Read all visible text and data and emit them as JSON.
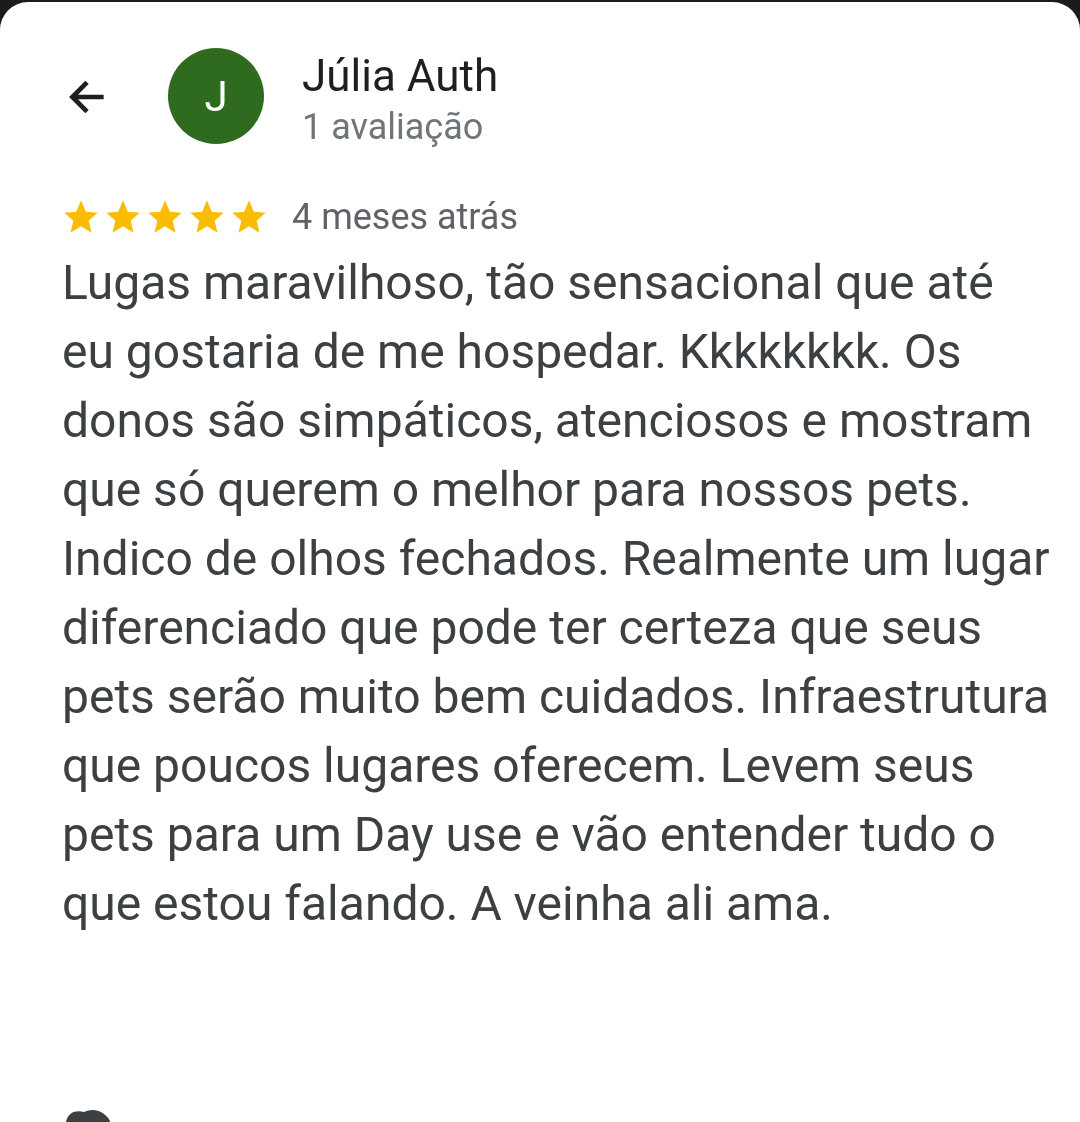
{
  "reviewer": {
    "avatar_letter": "J",
    "name": "Júlia Auth",
    "review_count": "1 avaliação"
  },
  "review": {
    "stars": 5,
    "time": "4 meses atrás",
    "text": "Lugas maravilhoso, tão sensacional que até eu gostaria de me hospedar. Kkkkkkkk. Os donos são simpáticos, atenciosos e mostram que só querem o melhor para nossos pets. Indico de olhos fechados. Realmente um lugar diferenciado que pode ter certeza que seus pets serão muito bem cuidados. Infraestrutura que poucos lugares oferecem. Levem seus pets para um Day use e vão entender tudo o que estou falando. A veinha ali ama."
  }
}
